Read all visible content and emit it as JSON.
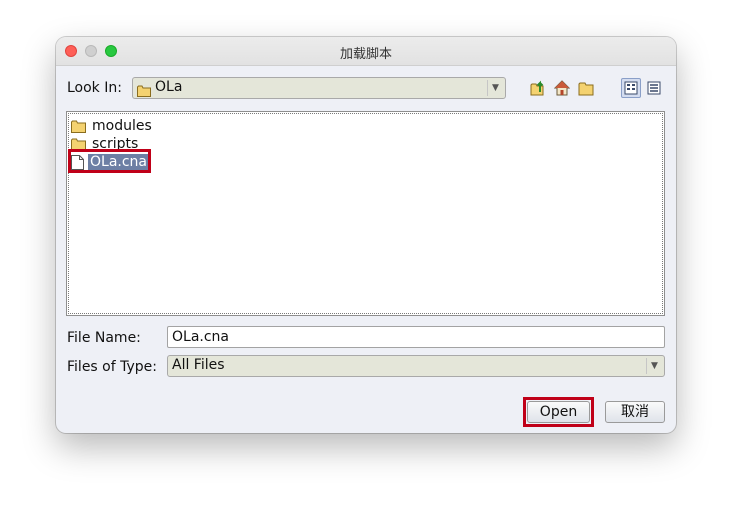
{
  "window": {
    "title": "加载脚本"
  },
  "look_in": {
    "label": "Look In:",
    "value": "OLa"
  },
  "toolbar": {
    "up_icon": "up-folder-icon",
    "home_icon": "home-icon",
    "new_folder_icon": "new-folder-icon",
    "list_view_icon": "list-view-icon",
    "details_view_icon": "details-view-icon"
  },
  "files": [
    {
      "name": "modules",
      "type": "folder"
    },
    {
      "name": "scripts",
      "type": "folder"
    },
    {
      "name": "OLa.cna",
      "type": "file",
      "selected": true
    }
  ],
  "file_name": {
    "label": "File Name:",
    "value": "OLa.cna"
  },
  "files_of_type": {
    "label": "Files of Type:",
    "value": "All Files"
  },
  "buttons": {
    "open": "Open",
    "cancel": "取消"
  },
  "colors": {
    "highlight_outline": "#c00018",
    "selection": "#6d7fa4",
    "folder_yellow": "#f4d270"
  }
}
